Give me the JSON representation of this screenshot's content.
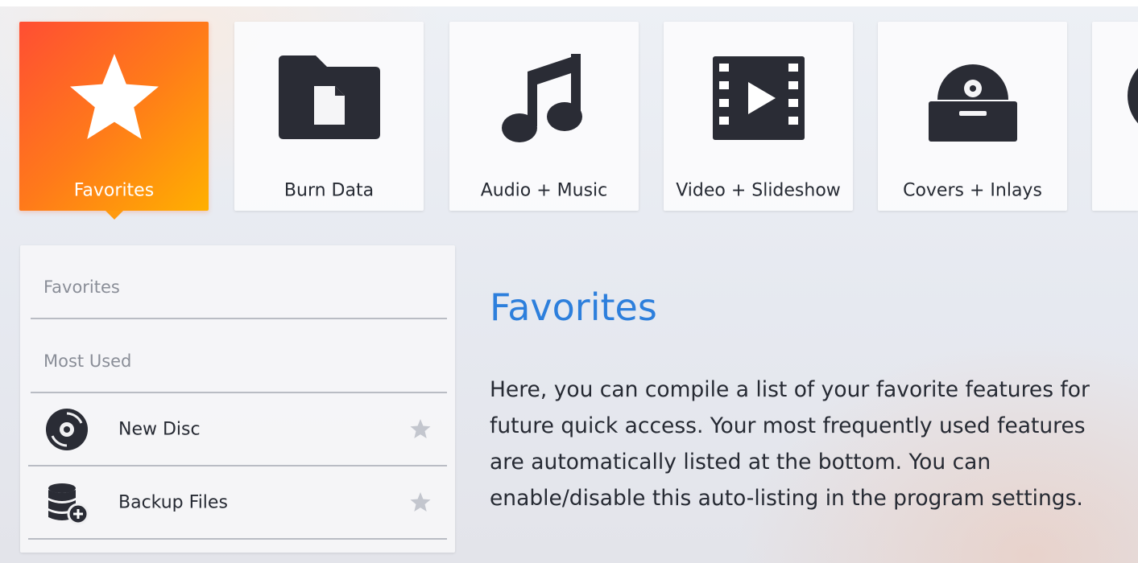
{
  "tiles": [
    {
      "label": "Favorites",
      "icon": "star-icon",
      "active": true
    },
    {
      "label": "Burn Data",
      "icon": "folder-file-icon",
      "active": false
    },
    {
      "label": "Audio + Music",
      "icon": "music-note-icon",
      "active": false
    },
    {
      "label": "Video + Slideshow",
      "icon": "film-play-icon",
      "active": false
    },
    {
      "label": "Covers + Inlays",
      "icon": "disc-tray-icon",
      "active": false
    }
  ],
  "sidebar": {
    "sections": [
      {
        "label": "Favorites"
      },
      {
        "label": "Most Used"
      }
    ],
    "items": [
      {
        "label": "New Disc",
        "icon": "disc-icon"
      },
      {
        "label": "Backup Files",
        "icon": "database-add-icon"
      }
    ]
  },
  "content": {
    "title": "Favorites",
    "description": "Here, you can compile a list of your favorite features for future quick access. Your most frequently used features are automatically listed at the bottom. You can enable/disable this auto-listing in the program settings."
  },
  "colors": {
    "accent_gradient_start": "#ff4e33",
    "accent_gradient_end": "#ffb000",
    "title_blue": "#2d7fdc",
    "icon_dark": "#2a2c35",
    "star_inactive": "#c3c6ce"
  }
}
